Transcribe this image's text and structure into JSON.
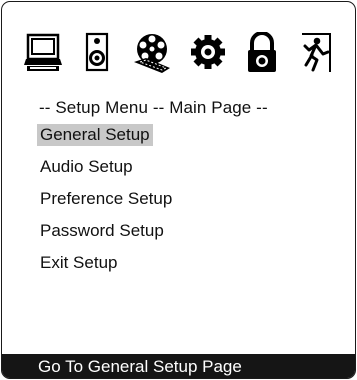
{
  "toolbar": {
    "icons": [
      {
        "name": "monitor-icon",
        "label": "General"
      },
      {
        "name": "speaker-icon",
        "label": "Audio"
      },
      {
        "name": "film-reel-icon",
        "label": "Preference"
      },
      {
        "name": "gear-icon",
        "label": "Setup"
      },
      {
        "name": "lock-icon",
        "label": "Password"
      },
      {
        "name": "exit-door-icon",
        "label": "Exit"
      }
    ]
  },
  "header": {
    "title": "-- Setup Menu -- Main Page --"
  },
  "menu": {
    "items": [
      {
        "label": "General Setup",
        "selected": true
      },
      {
        "label": "Audio Setup",
        "selected": false
      },
      {
        "label": "Preference Setup",
        "selected": false
      },
      {
        "label": "Password Setup",
        "selected": false
      },
      {
        "label": "Exit Setup",
        "selected": false
      }
    ]
  },
  "status": {
    "text": "Go To General Setup Page"
  },
  "colors": {
    "selection": "#c8c8c8",
    "status_bar": "#151515",
    "frame": "#1a1a1a"
  }
}
